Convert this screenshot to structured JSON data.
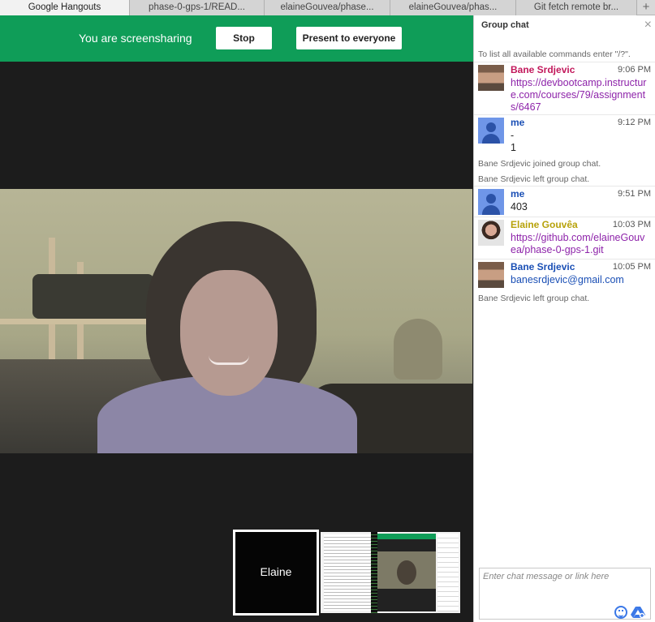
{
  "browser": {
    "tabs": [
      {
        "label": "Google Hangouts",
        "active": true
      },
      {
        "label": "phase-0-gps-1/READ...",
        "active": false
      },
      {
        "label": "elaineGouvea/phase...",
        "active": false
      },
      {
        "label": "elaineGouvea/phas...",
        "active": false
      },
      {
        "label": "Git fetch remote br...",
        "active": false
      }
    ],
    "new_tab_label": "+"
  },
  "banner": {
    "text": "You are screensharing",
    "stop_label": "Stop",
    "present_label": "Present to everyone",
    "color": "#0f9d58"
  },
  "thumbnails": {
    "self_label": "Elaine"
  },
  "chat": {
    "title": "Group chat",
    "close_icon": "×",
    "hint": "To list all available commands enter \"/?\".",
    "messages": [
      {
        "sender": "Bane Srdjevic",
        "sender_color": "#c2185b",
        "time": "9:06 PM",
        "lines": [
          "https://devbootcamp.instructure.com/courses/79/assignments/6467"
        ],
        "avatar": "bane"
      },
      {
        "sender": "me",
        "sender_color": "#1a4fb5",
        "time": "9:12 PM",
        "lines": [
          "-",
          "1"
        ],
        "avatar": "default"
      },
      {
        "sender": "me",
        "sender_color": "#1a4fb5",
        "time": "9:51 PM",
        "lines": [
          "403"
        ],
        "avatar": "default"
      },
      {
        "sender": "Elaine Gouvêa",
        "sender_color": "#b7a20a",
        "time": "10:03 PM",
        "lines": [
          "https://github.com/elaineGouvea/phase-0-gps-1.git"
        ],
        "avatar": "elaine"
      },
      {
        "sender": "Bane Srdjevic",
        "sender_color": "#1a4fb5",
        "time": "10:05 PM",
        "lines": [
          "banesrdjevic@gmail.com"
        ],
        "avatar": "bane"
      }
    ],
    "system": {
      "joined": "Bane Srdjevic joined group chat.",
      "left1": "Bane Srdjevic left group chat.",
      "left2": "Bane Srdjevic left group chat."
    },
    "input_placeholder": "Enter chat message or link here"
  }
}
